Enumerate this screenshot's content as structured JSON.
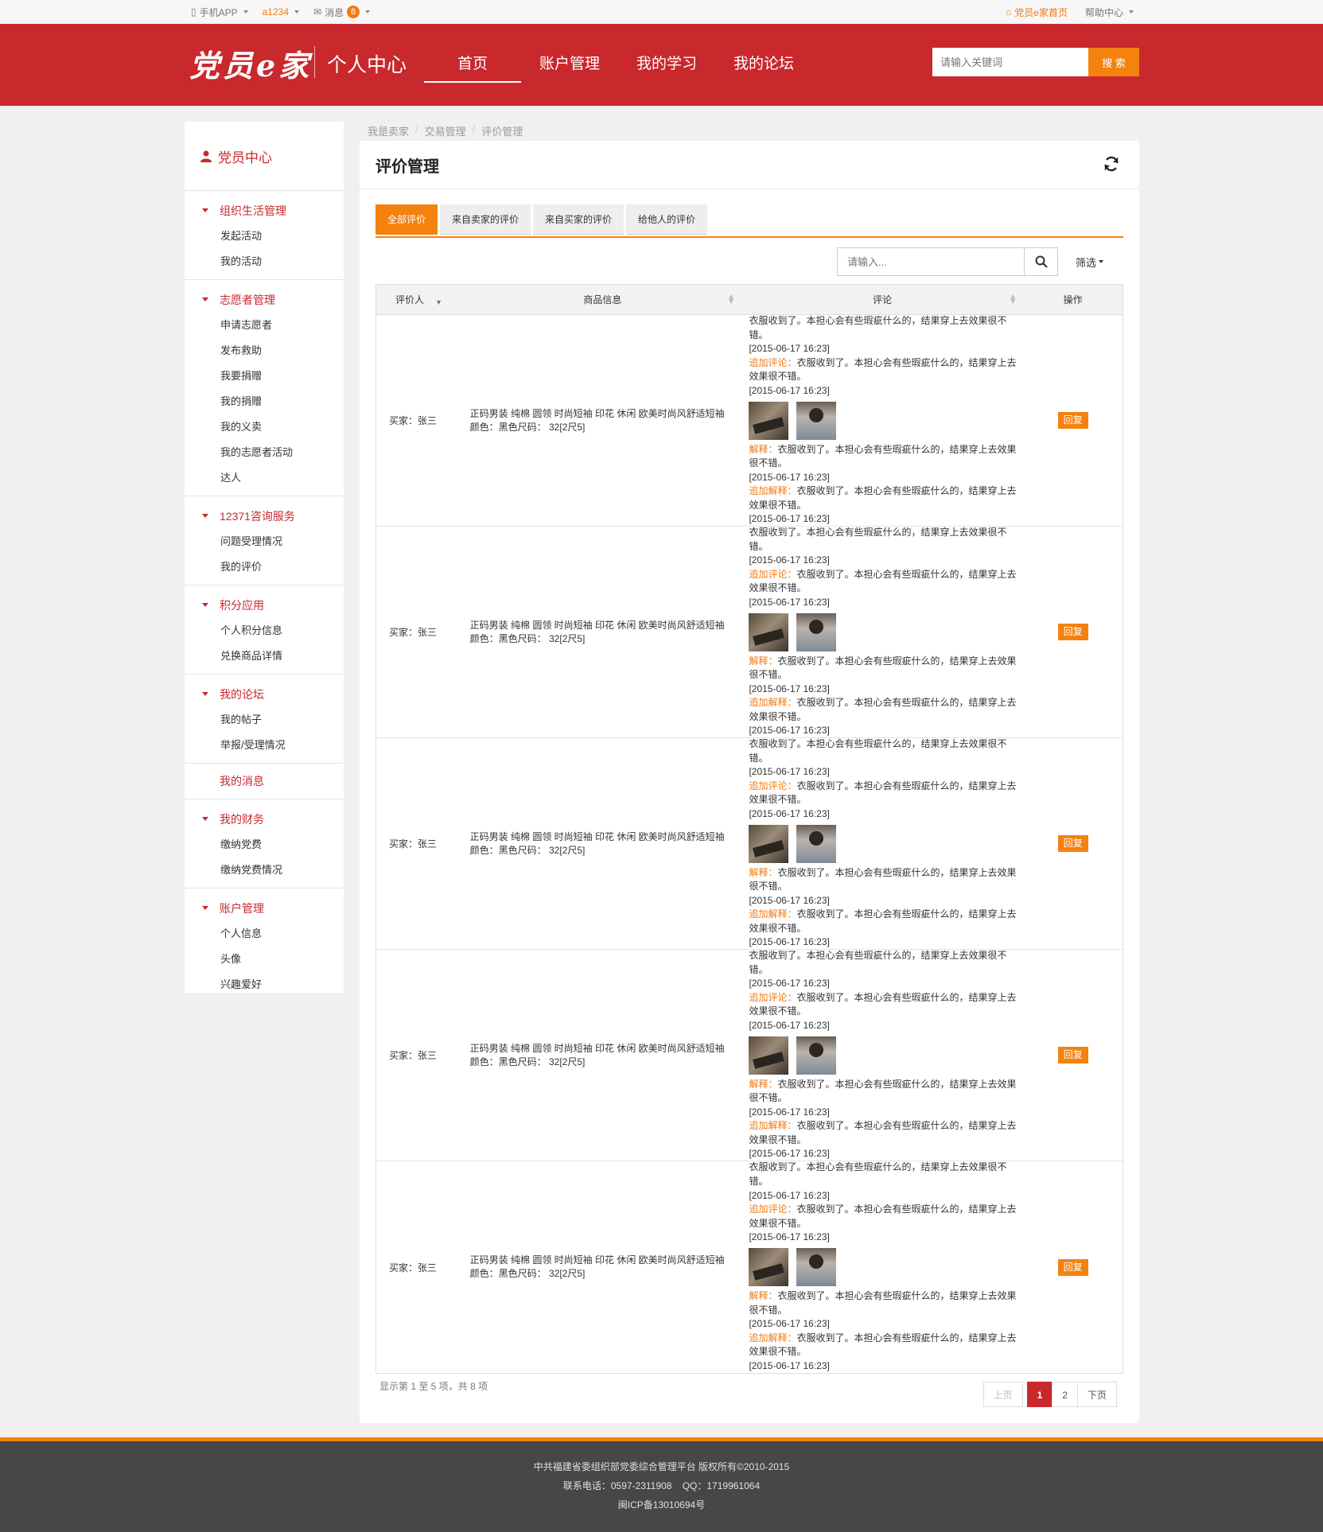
{
  "topbar": {
    "app": "手机APP",
    "user": "a1234",
    "messages": "消息",
    "message_count": "8",
    "home_link": "党员e家首页",
    "help": "帮助中心"
  },
  "header": {
    "logo": "党员e家",
    "subtitle": "个人中心",
    "nav": [
      "首页",
      "账户管理",
      "我的学习",
      "我的论坛"
    ],
    "search_placeholder": "请输入关键词",
    "search_button": "搜 索"
  },
  "sidebar": {
    "title": "党员中心",
    "groups": [
      {
        "title": "组织生活管理",
        "items": [
          "发起活动",
          "我的活动"
        ]
      },
      {
        "title": "志愿者管理",
        "items": [
          "申请志愿者",
          "发布救助",
          "我要捐赠",
          "我的捐赠",
          "我的义卖",
          "我的志愿者活动",
          "达人"
        ]
      },
      {
        "title": "12371咨询服务",
        "items": [
          "问题受理情况",
          "我的评价"
        ]
      },
      {
        "title": "积分应用",
        "items": [
          "个人积分信息",
          "兑换商品详情"
        ]
      },
      {
        "title": "我的论坛",
        "items": [
          "我的帖子",
          "举报/受理情况"
        ]
      }
    ],
    "single": "我的消息",
    "groups2": [
      {
        "title": "我的财务",
        "items": [
          "缴纳党费",
          "缴纳党费情况"
        ]
      },
      {
        "title": "账户管理",
        "items": [
          "个人信息",
          "头像",
          "兴趣爱好"
        ]
      }
    ]
  },
  "breadcrumb": [
    "我是卖家",
    "交易管理",
    "评价管理"
  ],
  "page_title": "评价管理",
  "tabs": [
    "全部评价",
    "来自卖家的评价",
    "来自买家的评价",
    "给他人的评价"
  ],
  "filter": {
    "placeholder": "请输入...",
    "select": "筛选"
  },
  "table": {
    "headers": [
      "评价人",
      "商品信息",
      "评论",
      "操作"
    ],
    "rows": [
      {
        "reviewer": "买家：张三",
        "product": "正码男装 纯棉 圆领 时尚短袖 印花 休闲 欧美时尚风舒适短袖",
        "spec": "颜色：黑色尺码： 32[2尺5]"
      },
      {
        "reviewer": "买家：张三",
        "product": "正码男装 纯棉 圆领 时尚短袖 印花 休闲 欧美时尚风舒适短袖",
        "spec": "颜色：黑色尺码： 32[2尺5]"
      },
      {
        "reviewer": "买家：张三",
        "product": "正码男装 纯棉 圆领 时尚短袖 印花 休闲 欧美时尚风舒适短袖",
        "spec": "颜色：黑色尺码： 32[2尺5]"
      },
      {
        "reviewer": "买家：张三",
        "product": "正码男装 纯棉 圆领 时尚短袖 印花 休闲 欧美时尚风舒适短袖",
        "spec": "颜色：黑色尺码： 32[2尺5]"
      },
      {
        "reviewer": "买家：张三",
        "product": "正码男装 纯棉 圆领 时尚短袖 印花 休闲 欧美时尚风舒适短袖",
        "spec": "颜色：黑色尺码： 32[2尺5]"
      }
    ],
    "review_text": "衣服收到了。本担心会有些瑕疵什么的，结果穿上去效果很不错。",
    "date": "[2015-06-17 16:23]",
    "add_review_label": "追加评论：",
    "explain_label": "解释：",
    "add_explain_label": "追加解释：",
    "reply": "回复"
  },
  "pagination": {
    "info": "显示第 1 至 5 项，共 8 项",
    "prev": "上页",
    "pages": [
      "1",
      "2"
    ],
    "next": "下页"
  },
  "footer": {
    "line1": "中共福建省委组织部党委综合管理平台 版权所有©2010-2015",
    "line2": "联系电话：0597-2311908    QQ：1719961064",
    "line3": "闽ICP备13010694号"
  },
  "colors": {
    "brand_red": "#c9282d",
    "accent_orange": "#f5820f",
    "footer": "#474747"
  }
}
